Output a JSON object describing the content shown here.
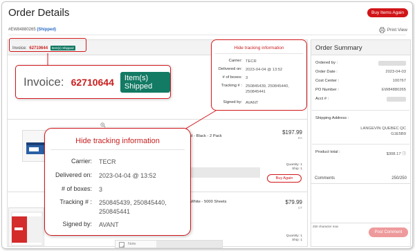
{
  "header": {
    "title": "Order Details",
    "buy_again_label": "Buy Items Again",
    "order_number": "#EW84880265",
    "order_status": "(Shipped)",
    "print_label": "Print View"
  },
  "invoice": {
    "label": "Invoice:",
    "number": "62710644",
    "status_badge": "Item(s) Shipped"
  },
  "tracking": {
    "hide_label": "Hide tracking information",
    "carrier_label": "Carrier:",
    "carrier": "TECR",
    "delivered_label": "Delivered on:",
    "delivered": "2023-04-04 @ 13:52",
    "boxes_label": "# of boxes:",
    "boxes": "3",
    "tracking_label": "Tracking # :",
    "tracking_small_1": "250845439,  250845440,",
    "tracking_small_2": "250845441",
    "tracking_big_1": "250845439,  250845440,",
    "tracking_big_2": "250845441",
    "signed_label": "Signed by:",
    "signed": "AVANT"
  },
  "products": [
    {
      "title": "Brother TN760 Toner Cartridges - High Yield - Black - 2 Pack",
      "price": "$197.99",
      "unit": "EA",
      "quantity": "Quantity: 1",
      "ship": "Ship: 1",
      "buy_again": "Buy Again"
    },
    {
      "title": "White - 5000 Sheets",
      "price": "$79.99",
      "unit": "CT",
      "quantity": "Quantity: 1",
      "ship": "Ship: 1",
      "note_placeholder": "Note"
    }
  ],
  "summary": {
    "title": "Order Summary",
    "ordered_by_label": "Ordered by :",
    "order_date_label": "Order Date :",
    "order_date": "2023-04-03",
    "cost_center_label": "Cost Center :",
    "cost_center": "100767",
    "po_number_label": "PO Number :",
    "po_number": "EW84880265",
    "acct_label": "Acct # :",
    "shipping_label": "Shipping Address :",
    "address_line1": "LANGEVIN QUEBEC QC",
    "address_line2": "G1E5B9",
    "product_total_label": "Product total :",
    "product_total": "$308.17",
    "comments_label": "Comments",
    "comments_count": "250/250",
    "char_max": "250 character max",
    "post_comment": "Post Comment"
  },
  "colors": {
    "brand_red": "#d01418",
    "badge_green": "#137a64",
    "link_blue": "#2b6cc4"
  }
}
